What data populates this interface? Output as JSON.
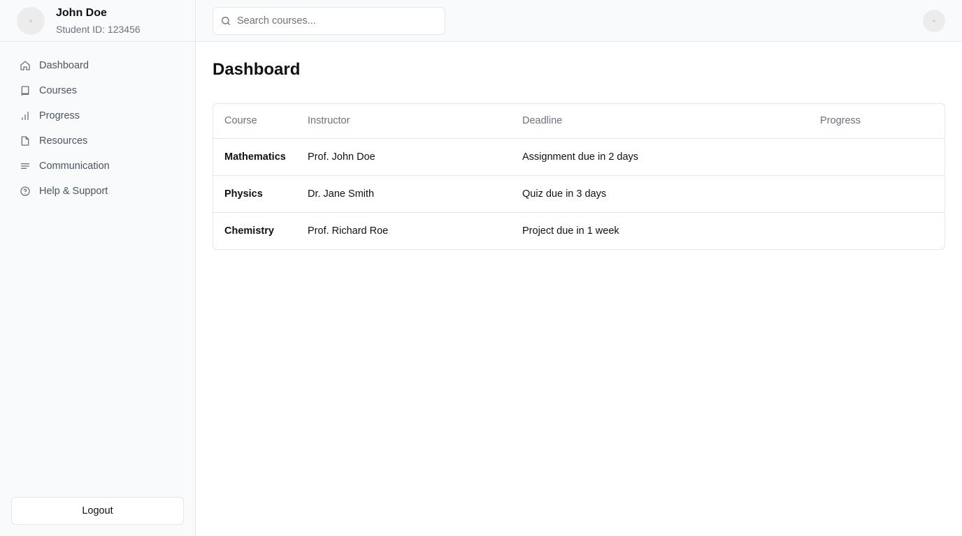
{
  "user": {
    "name": "John Doe",
    "student_id": "Student ID: 123456"
  },
  "sidebar": {
    "items": [
      {
        "label": "Dashboard",
        "icon": "home-icon"
      },
      {
        "label": "Courses",
        "icon": "book-icon"
      },
      {
        "label": "Progress",
        "icon": "bar-chart-icon"
      },
      {
        "label": "Resources",
        "icon": "file-icon"
      },
      {
        "label": "Communication",
        "icon": "text-lines-icon"
      },
      {
        "label": "Help & Support",
        "icon": "help-circle-icon"
      }
    ],
    "logout_label": "Logout"
  },
  "search": {
    "placeholder": "Search courses..."
  },
  "main": {
    "title": "Dashboard",
    "table": {
      "headers": [
        "Course",
        "Instructor",
        "Deadline",
        "Progress"
      ],
      "rows": [
        {
          "course": "Mathematics",
          "instructor": "Prof. John Doe",
          "deadline": "Assignment due in 2 days"
        },
        {
          "course": "Physics",
          "instructor": "Dr. Jane Smith",
          "deadline": "Quiz due in 3 days"
        },
        {
          "course": "Chemistry",
          "instructor": "Prof. Richard Roe",
          "deadline": "Project due in 1 week"
        }
      ]
    }
  },
  "colors": {
    "sidebar_bg": "#f9fafb",
    "border": "#e5e7eb",
    "muted_text": "#6b7280",
    "nav_text": "#4b5563"
  }
}
